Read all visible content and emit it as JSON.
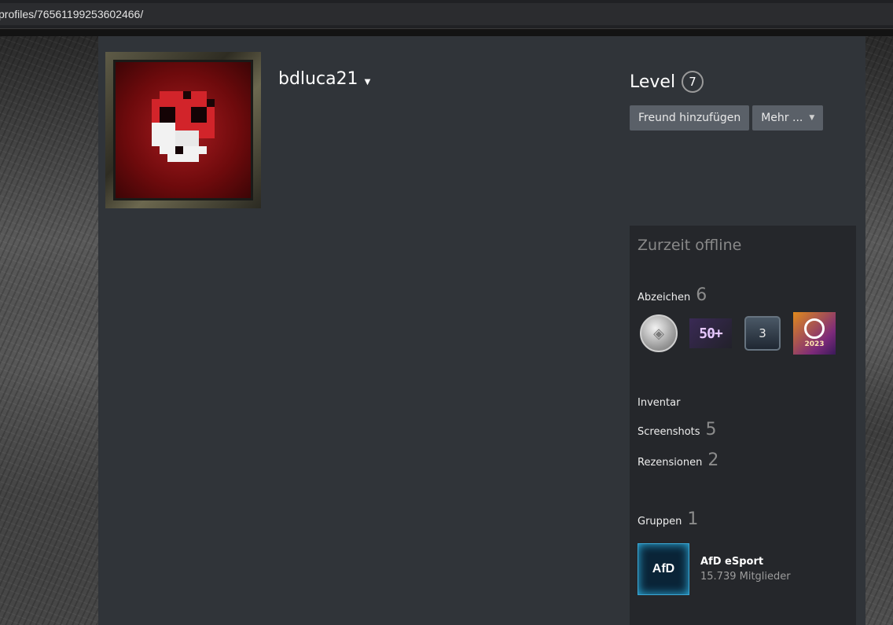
{
  "browser": {
    "url": "profiles/76561199253602466/"
  },
  "profile": {
    "persona_name": "bdluca21",
    "level_label": "Level",
    "level_value": "7",
    "buttons": {
      "add_friend": "Freund hinzufügen",
      "more": "Mehr ..."
    },
    "status": "Zurzeit offline",
    "badges": {
      "label": "Abzeichen",
      "count": "6",
      "items": [
        "coin-badge-icon",
        "50-plus-badge",
        "years-of-service-badge",
        "steam-2023-badge"
      ],
      "badge_50": "50+",
      "badge_years": "3",
      "badge_2023": "2023"
    },
    "inventory_label": "Inventar",
    "screenshots": {
      "label": "Screenshots",
      "count": "5"
    },
    "reviews": {
      "label": "Rezensionen",
      "count": "2"
    },
    "groups": {
      "label": "Gruppen",
      "count": "1",
      "items": [
        {
          "icon_text": "AfD",
          "name": "AfD eSport",
          "members": "15.739 Mitglieder"
        }
      ]
    }
  },
  "colors": {
    "panel": "#303439",
    "sidebar": "#25272b",
    "button": "#5a6068"
  }
}
